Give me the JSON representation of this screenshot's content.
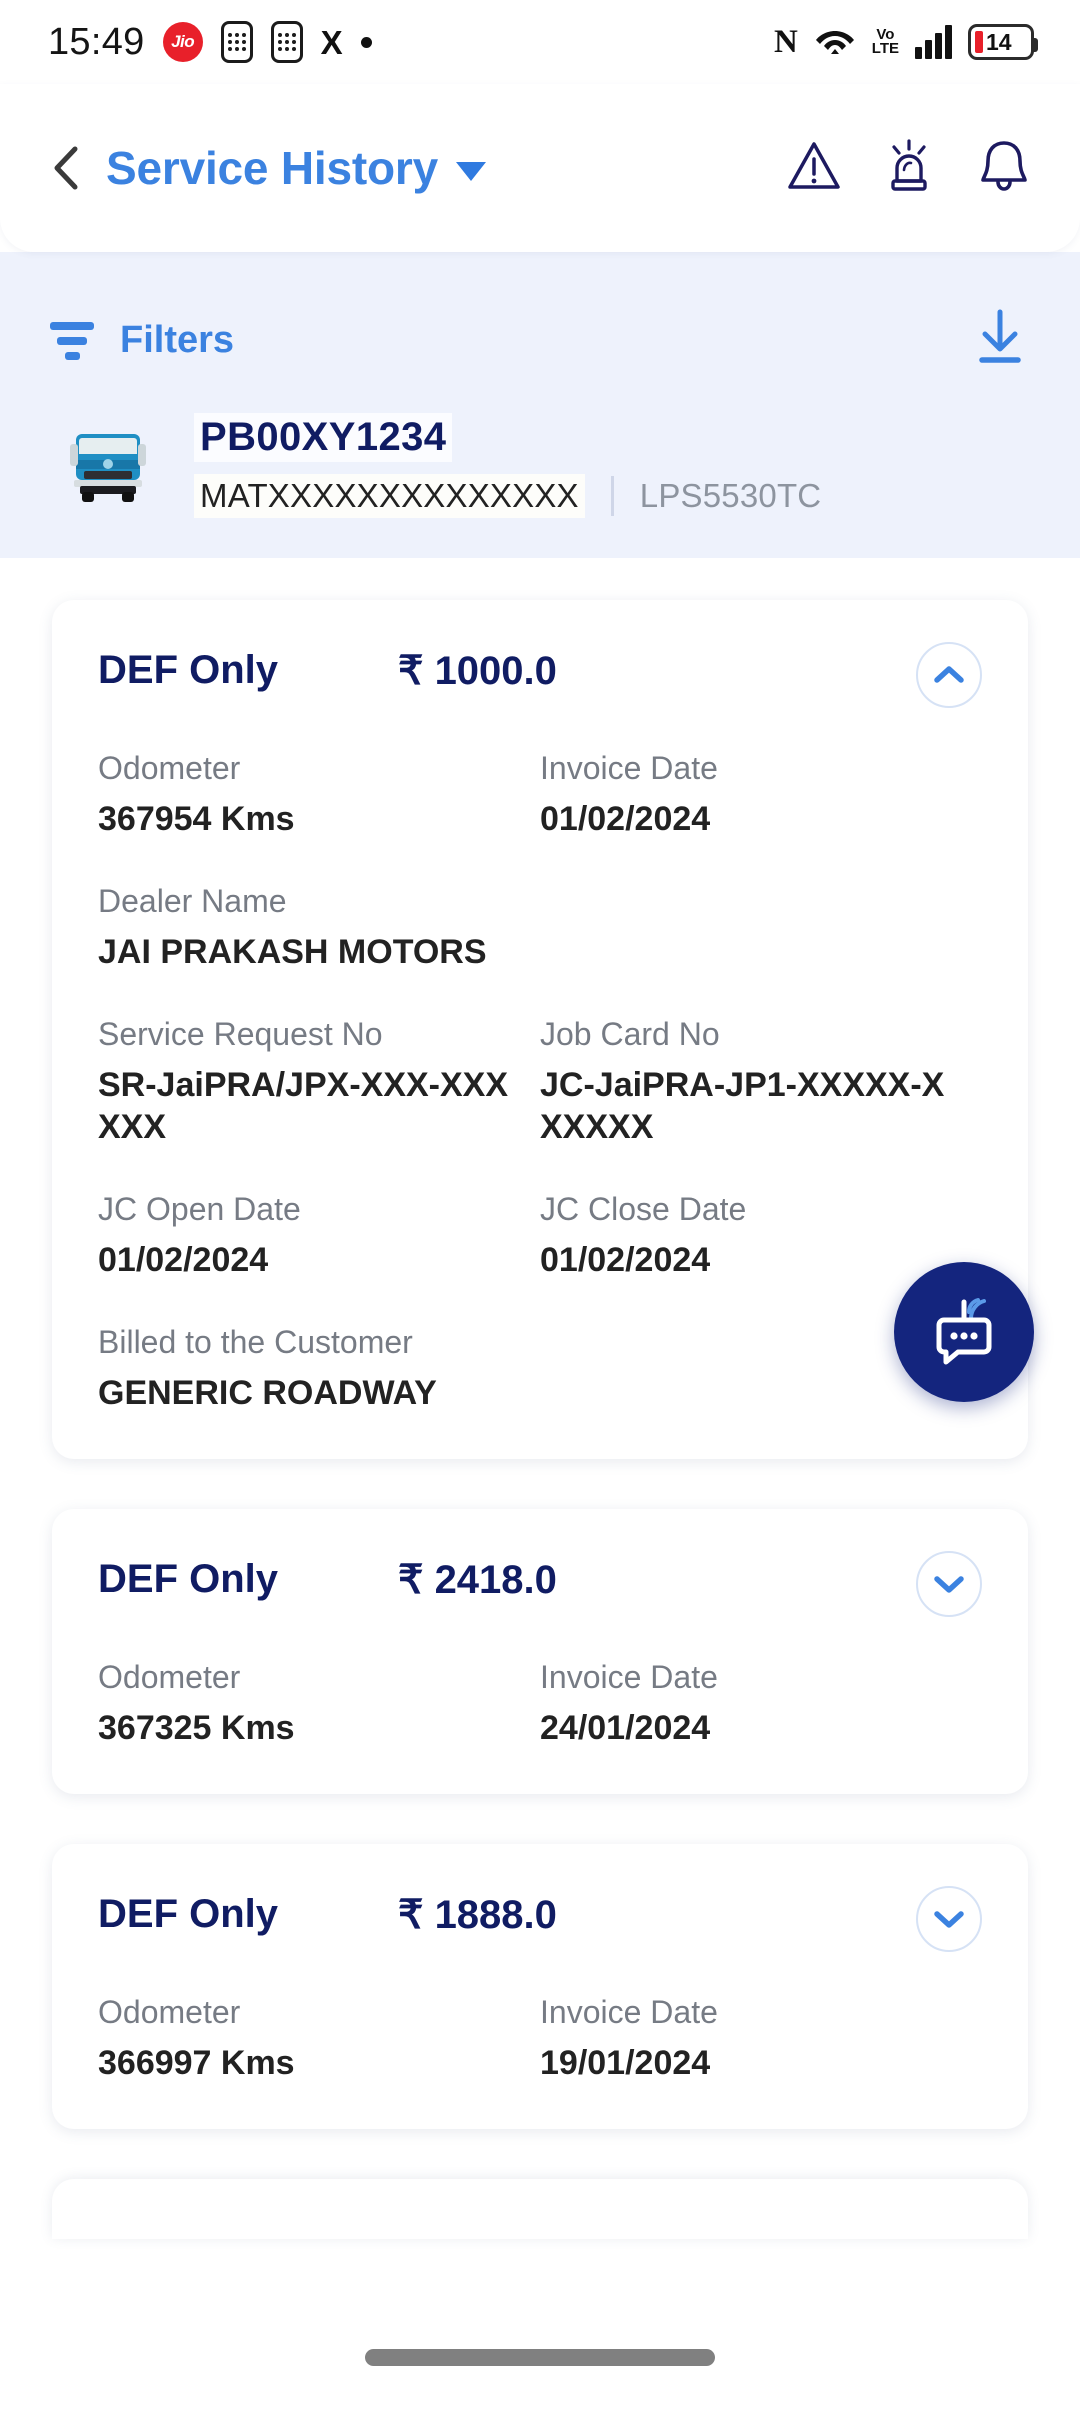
{
  "status_bar": {
    "time": "15:49",
    "carrier": "Jio",
    "x_logo": "X",
    "nfc": "N",
    "volte_top": "Vo",
    "volte_bottom": "LTE",
    "battery_percent": "14"
  },
  "header": {
    "back_icon": "chevron-left-icon",
    "title": "Service History",
    "dropdown_icon": "caret-down-icon",
    "icons": [
      "warning-triangle-icon",
      "siren-icon",
      "bell-icon"
    ]
  },
  "filters": {
    "label": "Filters",
    "filter_icon": "funnel-icon",
    "download_icon": "download-icon"
  },
  "vehicle": {
    "thumbnail": "truck-icon",
    "registration": "PB00XY1234",
    "vin": "MATXXXXXXXXXXXXXX",
    "model": "LPS5530TC"
  },
  "labels": {
    "odometer": "Odometer",
    "invoice_date": "Invoice Date",
    "dealer_name": "Dealer Name",
    "service_request_no": "Service Request No",
    "job_card_no": "Job Card No",
    "jc_open_date": "JC Open Date",
    "jc_close_date": "JC Close Date",
    "billed_to_customer": "Billed to the Customer"
  },
  "colors": {
    "accent_blue": "#3b82e0",
    "navy": "#101c63",
    "panel_bg": "#eef2fc",
    "fab_bg": "#14257e",
    "label_gray": "#767b84"
  },
  "service_cards": [
    {
      "type": "DEF Only",
      "price": "₹ 1000.0",
      "expanded": true,
      "chevron_icon": "chevron-up-icon",
      "odometer": "367954 Kms",
      "invoice_date": "01/02/2024",
      "dealer_name": "JAI PRAKASH MOTORS",
      "service_request_no": "SR-JaiPRA/JPX-XXX-XXXXXX",
      "job_card_no": "JC-JaiPRA-JP1-XXXXX-XXXXXX",
      "jc_open_date": "01/02/2024",
      "jc_close_date": "01/02/2024",
      "billed_to_customer": "GENERIC ROADWAY"
    },
    {
      "type": "DEF Only",
      "price": "₹ 2418.0",
      "expanded": false,
      "chevron_icon": "chevron-down-icon",
      "odometer": "367325 Kms",
      "invoice_date": "24/01/2024"
    },
    {
      "type": "DEF Only",
      "price": "₹ 1888.0",
      "expanded": false,
      "chevron_icon": "chevron-down-icon",
      "odometer": "366997 Kms",
      "invoice_date": "19/01/2024"
    }
  ],
  "chat_fab": {
    "icon": "chatbot-icon"
  }
}
